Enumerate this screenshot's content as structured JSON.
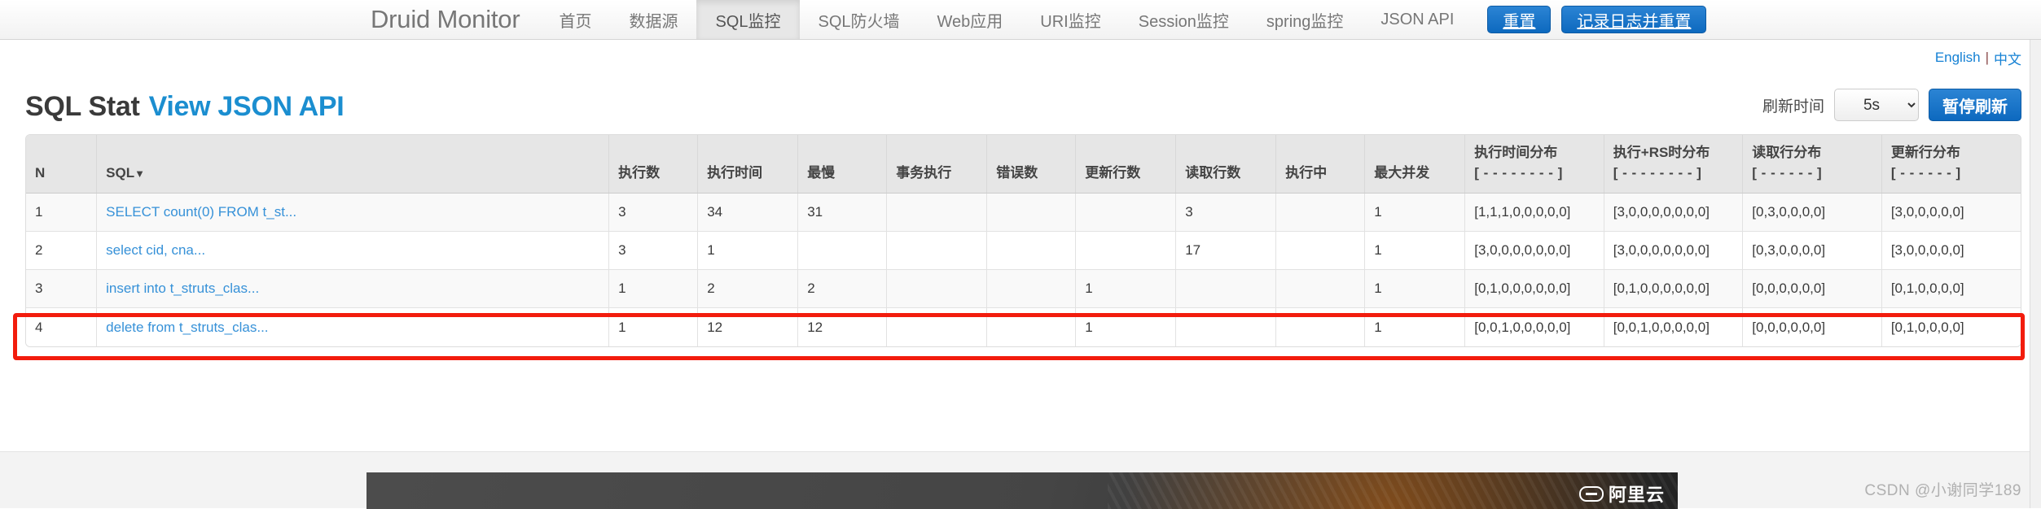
{
  "nav": {
    "brand": "Druid Monitor",
    "items": [
      {
        "label": "首页",
        "active": false
      },
      {
        "label": "数据源",
        "active": false
      },
      {
        "label": "SQL监控",
        "active": true
      },
      {
        "label": "SQL防火墙",
        "active": false
      },
      {
        "label": "Web应用",
        "active": false
      },
      {
        "label": "URI监控",
        "active": false
      },
      {
        "label": "Session监控",
        "active": false
      },
      {
        "label": "spring监控",
        "active": false
      },
      {
        "label": "JSON API",
        "active": false
      }
    ],
    "reset_button": "重置",
    "log_reset_button": "记录日志并重置"
  },
  "lang": {
    "english": "English",
    "separator": "|",
    "chinese": "中文"
  },
  "header": {
    "title": "SQL Stat",
    "api_link": "View JSON API",
    "refresh_label": "刷新时间",
    "refresh_value": "5s",
    "refresh_options": [
      "5s"
    ],
    "pause_button": "暂停刷新"
  },
  "table": {
    "columns": [
      {
        "key": "n",
        "label": "N",
        "sub": ""
      },
      {
        "key": "sql",
        "label": "SQL",
        "sub": "",
        "sort_caret": "▼"
      },
      {
        "key": "exec_count",
        "label": "执行数",
        "sub": ""
      },
      {
        "key": "exec_time",
        "label": "执行时间",
        "sub": ""
      },
      {
        "key": "slowest",
        "label": "最慢",
        "sub": ""
      },
      {
        "key": "in_transaction",
        "label": "事务执行",
        "sub": ""
      },
      {
        "key": "error_count",
        "label": "错误数",
        "sub": ""
      },
      {
        "key": "update_count",
        "label": "更新行数",
        "sub": ""
      },
      {
        "key": "fetch_count",
        "label": "读取行数",
        "sub": ""
      },
      {
        "key": "running",
        "label": "执行中",
        "sub": ""
      },
      {
        "key": "max_concurrent",
        "label": "最大并发",
        "sub": ""
      },
      {
        "key": "exec_time_hist",
        "label": "执行时间分布",
        "sub": "[ - - - - - - - - ]"
      },
      {
        "key": "exec_rs_hist",
        "label": "执行+RS时分布",
        "sub": "[ - - - - - - - - ]"
      },
      {
        "key": "fetch_row_hist",
        "label": "读取行分布",
        "sub": "[ - - - - - - ]"
      },
      {
        "key": "update_row_hist",
        "label": "更新行分布",
        "sub": "[ - - - - - - ]"
      }
    ],
    "rows": [
      {
        "n": "1",
        "sql": "SELECT count(0) FROM t_st...",
        "exec_count": "3",
        "exec_time": "34",
        "slowest": "31",
        "in_transaction": "",
        "error_count": "",
        "update_count": "",
        "fetch_count": "3",
        "running": "",
        "max_concurrent": "1",
        "exec_time_hist": "[1,1,1,0,0,0,0,0]",
        "exec_rs_hist": "[3,0,0,0,0,0,0,0]",
        "fetch_row_hist": "[0,3,0,0,0,0]",
        "update_row_hist": "[3,0,0,0,0,0]",
        "highlighted": false
      },
      {
        "n": "2",
        "sql": "select cid, cna...",
        "exec_count": "3",
        "exec_time": "1",
        "slowest": "",
        "in_transaction": "",
        "error_count": "",
        "update_count": "",
        "fetch_count": "17",
        "running": "",
        "max_concurrent": "1",
        "exec_time_hist": "[3,0,0,0,0,0,0,0]",
        "exec_rs_hist": "[3,0,0,0,0,0,0,0]",
        "fetch_row_hist": "[0,3,0,0,0,0]",
        "update_row_hist": "[3,0,0,0,0,0]",
        "highlighted": false
      },
      {
        "n": "3",
        "sql": "insert into t_struts_clas...",
        "exec_count": "1",
        "exec_time": "2",
        "slowest": "2",
        "in_transaction": "",
        "error_count": "",
        "update_count": "1",
        "fetch_count": "",
        "running": "",
        "max_concurrent": "1",
        "exec_time_hist": "[0,1,0,0,0,0,0,0]",
        "exec_rs_hist": "[0,1,0,0,0,0,0,0]",
        "fetch_row_hist": "[0,0,0,0,0,0]",
        "update_row_hist": "[0,1,0,0,0,0]",
        "highlighted": true
      },
      {
        "n": "4",
        "sql": "delete from t_struts_clas...",
        "exec_count": "1",
        "exec_time": "12",
        "slowest": "12",
        "in_transaction": "",
        "error_count": "",
        "update_count": "1",
        "fetch_count": "",
        "running": "",
        "max_concurrent": "1",
        "exec_time_hist": "[0,0,1,0,0,0,0,0]",
        "exec_rs_hist": "[0,0,1,0,0,0,0,0]",
        "fetch_row_hist": "[0,0,0,0,0,0]",
        "update_row_hist": "[0,1,0,0,0,0]",
        "highlighted": false
      }
    ]
  },
  "footer": {
    "ad_logo_text": "阿里云",
    "watermark": "CSDN @小谢同学189"
  },
  "colors": {
    "accent_blue": "#1b8ed0",
    "link_blue": "#3691d8",
    "button_blue": "#0d69bf",
    "highlight_red": "#f21c0d",
    "header_gray": "#e6e6e6"
  }
}
